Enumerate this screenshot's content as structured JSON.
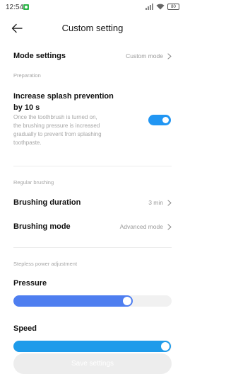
{
  "status_bar": {
    "time": "12:54",
    "battery": "80"
  },
  "header": {
    "title": "Custom setting"
  },
  "mode_settings": {
    "label": "Mode settings",
    "value": "Custom mode"
  },
  "preparation": {
    "section_label": "Preparation",
    "splash_title": "Increase splash prevention by 10 s",
    "splash_description": "Once the toothbrush is turned on, the brushing pressure is increased gradually to prevent from splashing toothpaste.",
    "splash_enabled": true
  },
  "regular_brushing": {
    "section_label": "Regular brushing",
    "duration_label": "Brushing duration",
    "duration_value": "3 min",
    "mode_label": "Brushing mode",
    "mode_value": "Advanced mode"
  },
  "stepless_power": {
    "section_label": "Stepless power adjustment",
    "pressure_label": "Pressure",
    "pressure_level": 0.72,
    "speed_label": "Speed",
    "speed_level": 0.96
  },
  "footer": {
    "save_label": "Save settings"
  },
  "colors": {
    "accent_blue": "#2196f3",
    "pressure_fill": "#4e7ef0",
    "speed_fill": "#1e9bea",
    "disabled_button": "#ededed"
  },
  "icons": {
    "back": "back-arrow-icon",
    "chevron": "chevron-right-icon",
    "notification": "notification-app-icon",
    "signal": "signal-icon",
    "wifi": "wifi-icon",
    "battery": "battery-icon"
  }
}
